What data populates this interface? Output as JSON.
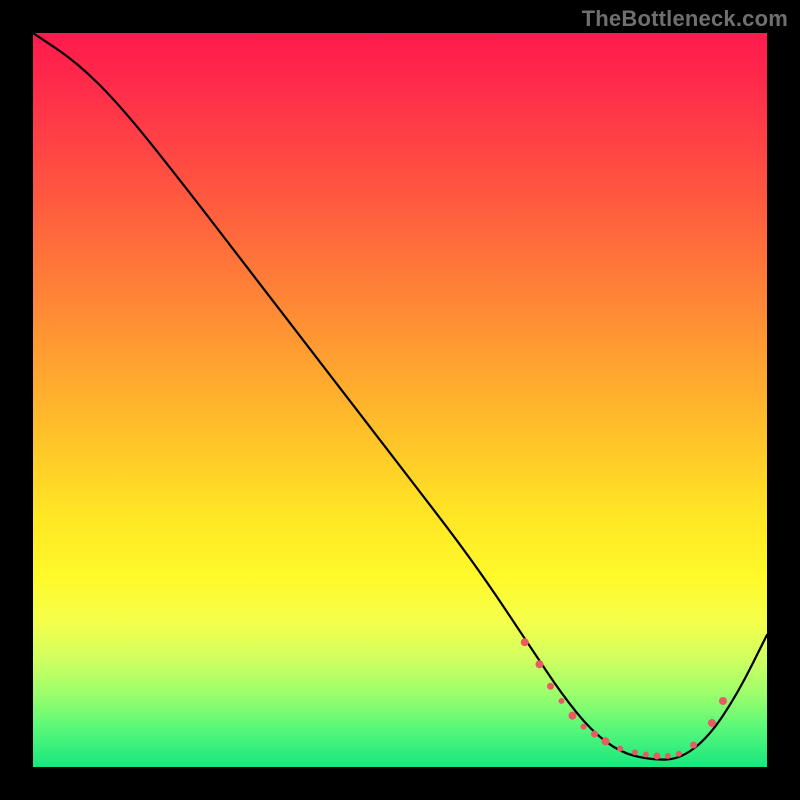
{
  "attribution": "TheBottleneck.com",
  "colors": {
    "dot": "#e95a63",
    "curve": "#000000",
    "background_border": "#000000"
  },
  "chart_data": {
    "type": "line",
    "title": "",
    "xlabel": "",
    "ylabel": "",
    "xlim": [
      0,
      100
    ],
    "ylim": [
      0,
      100
    ],
    "series": [
      {
        "name": "bottleneck-curve",
        "x": [
          0,
          6,
          12,
          20,
          30,
          40,
          50,
          60,
          68,
          72,
          76,
          80,
          84,
          88,
          92,
          96,
          100
        ],
        "y": [
          100,
          96,
          90,
          80,
          67,
          54,
          41,
          28,
          16,
          10,
          5,
          2,
          1,
          1,
          4,
          10,
          18
        ]
      }
    ],
    "markers": {
      "name": "highlight-cluster",
      "x": [
        67,
        69,
        70.5,
        72,
        73.5,
        75,
        76.5,
        78,
        80,
        82,
        83.5,
        85,
        86.5,
        88,
        90,
        92.5,
        94
      ],
      "y": [
        17,
        14,
        11,
        9,
        7,
        5.5,
        4.5,
        3.5,
        2.5,
        2,
        1.7,
        1.5,
        1.5,
        1.8,
        3,
        6,
        9
      ],
      "r": [
        4,
        4,
        3.5,
        3,
        4,
        3,
        3.5,
        4,
        3,
        3,
        3,
        3.5,
        3,
        3,
        3.5,
        4,
        4
      ]
    }
  }
}
